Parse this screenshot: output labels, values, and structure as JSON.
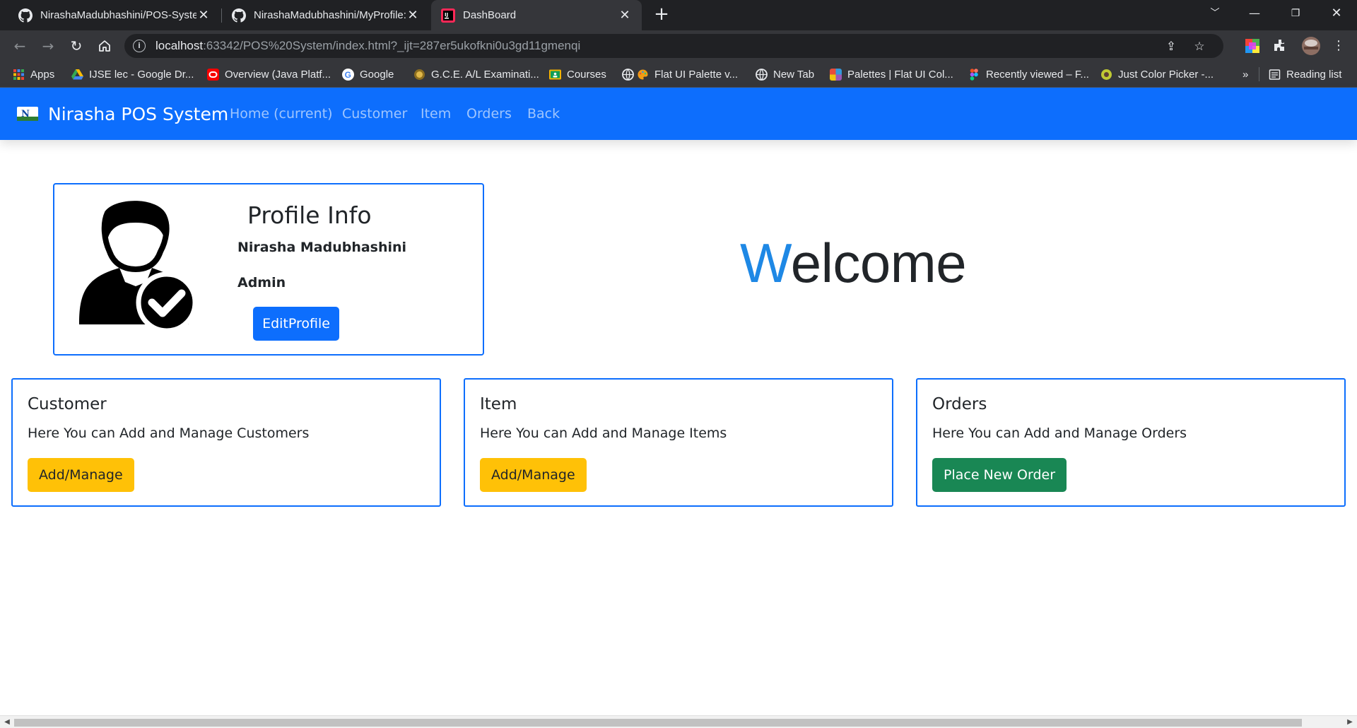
{
  "browser": {
    "tabs": [
      {
        "title": "NirashaMadubhashini/POS-Syste",
        "active": false,
        "icon": "github-icon"
      },
      {
        "title": "NirashaMadubhashini/MyProfile:",
        "active": false,
        "icon": "github-icon"
      },
      {
        "title": "DashBoard",
        "active": true,
        "icon": "intellij-icon"
      }
    ],
    "new_tab_label": "+",
    "url_host": "localhost",
    "url_rest": ":63342/POS%20System/index.html?_ijt=287er5ukofkni0u3gd11gmenqi",
    "bookmarks": [
      {
        "label": "Apps",
        "icon": "apps-grid-icon",
        "color": "#4285f4"
      },
      {
        "label": "IJSE lec - Google Dr...",
        "icon": "google-drive-icon",
        "color": "#fbbc04"
      },
      {
        "label": "Overview (Java Platf...",
        "icon": "oracle-icon",
        "color": "#f80000"
      },
      {
        "label": "Google",
        "icon": "google-icon",
        "color": "#ffffff"
      },
      {
        "label": "G.C.E. A/L Examinati...",
        "icon": "emblem-icon",
        "color": "#c9a227"
      },
      {
        "label": "Courses",
        "icon": "classroom-icon",
        "color": "#f4b400"
      },
      {
        "label": "Flat UI Palette v...",
        "icon": "palette-icon",
        "color": "#f39c12"
      },
      {
        "label": "New Tab",
        "icon": "globe-icon",
        "color": "#e8eaed"
      },
      {
        "label": "Palettes | Flat UI Col...",
        "icon": "palettes-icon",
        "color": "#e74c3c"
      },
      {
        "label": "Recently viewed – F...",
        "icon": "figma-icon",
        "color": "#f24e1e"
      },
      {
        "label": "Just Color Picker -...",
        "icon": "color-picker-icon",
        "color": "#8bc34a"
      }
    ],
    "bookmarks_overflow": "»",
    "reading_list_label": "Reading list"
  },
  "navbar": {
    "brand": "Nirasha POS System",
    "links": [
      "Home (current)",
      "Customer",
      "Item",
      "Orders",
      "Back"
    ],
    "color": "#0d6efd"
  },
  "profile": {
    "title": "Profile Info",
    "name": "Nirasha Madubhashini",
    "role": "Admin",
    "edit_button": "EditProfile"
  },
  "welcome": {
    "first_letter": "W",
    "rest": "elcome"
  },
  "cards": [
    {
      "title": "Customer",
      "text": "Here You can Add and Manage Customers",
      "button": "Add/Manage",
      "button_style": "warning"
    },
    {
      "title": "Item",
      "text": "Here You can Add and Manage Items",
      "button": "Add/Manage",
      "button_style": "warning"
    },
    {
      "title": "Orders",
      "text": "Here You can Add and Manage Orders",
      "button": "Place New Order",
      "button_style": "success"
    }
  ]
}
